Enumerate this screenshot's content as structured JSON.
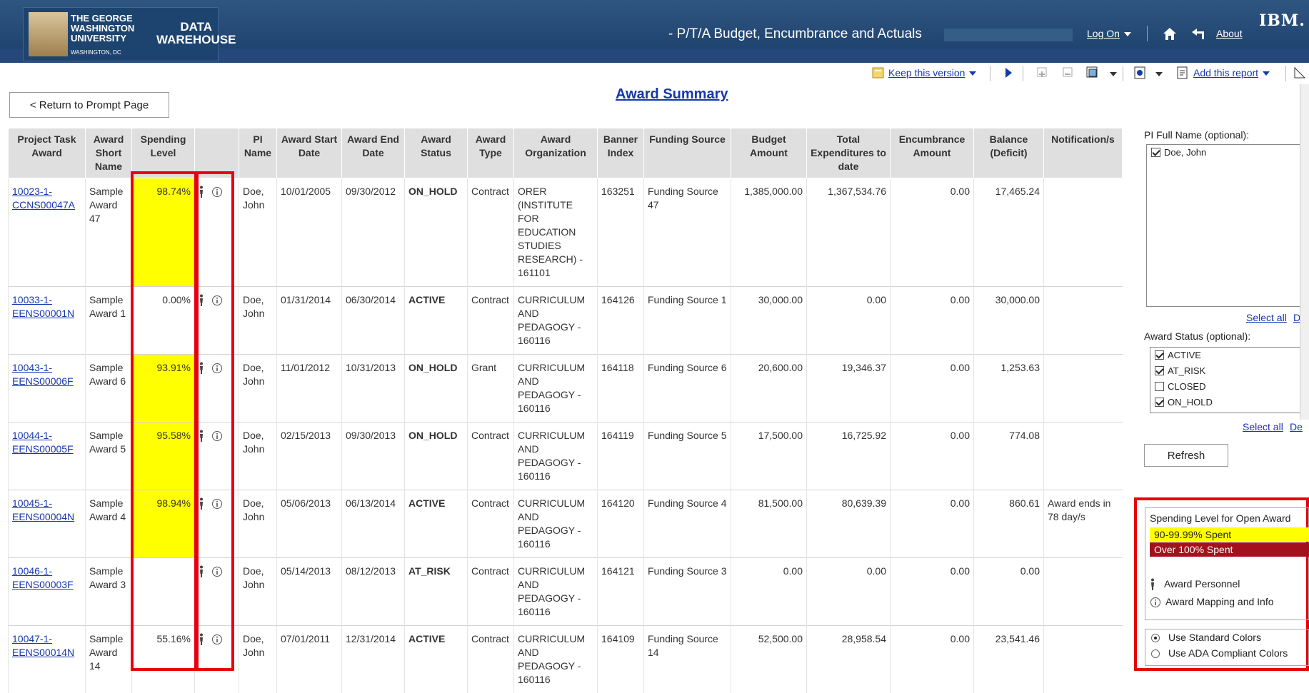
{
  "header": {
    "university": [
      "THE GEORGE",
      "WASHINGTON",
      "UNIVERSITY"
    ],
    "location": "WASHINGTON, DC",
    "product": [
      "DATA",
      "WAREHOUSE"
    ],
    "report_title": "- P/T/A Budget, Encumbrance and Actuals",
    "logon_label": "Log On",
    "about_label": "About",
    "ibm_label": "IBM."
  },
  "toolbar": {
    "keep_version_label": "Keep this version",
    "add_report_label": "Add this report"
  },
  "return_label": "< Return to Prompt Page",
  "page_title": "Award Summary",
  "table": {
    "headers": [
      "Project Task Award",
      "Award Short Name",
      "Spending Level",
      "",
      "PI Name",
      "Award Start Date",
      "Award End Date",
      "Award Status",
      "Award Type",
      "Award Organization",
      "Banner Index",
      "Funding Source",
      "Budget Amount",
      "Total Expenditures to date",
      "Encumbrance Amount",
      "Balance (Deficit)",
      "Notification/s"
    ],
    "rows": [
      {
        "project": "10023-1-CCNS00047A",
        "short_name": "Sample Award 47",
        "spending": "98.74%",
        "pi": "Doe, John",
        "start": "10/01/2005",
        "end": "09/30/2012",
        "status": "ON_HOLD",
        "type": "Contract",
        "org": "ORER (INSTITUTE FOR EDUCATION STUDIES RESEARCH) - 161101",
        "index": "163251",
        "funding": "Funding Source 47",
        "budget": "1,385,000.00",
        "expend": "1,367,534.76",
        "encumb": "0.00",
        "balance": "17,465.24",
        "notify": ""
      },
      {
        "project": "10033-1-EENS00001N",
        "short_name": "Sample Award 1",
        "spending": "0.00%",
        "pi": "Doe, John",
        "start": "01/31/2014",
        "end": "06/30/2014",
        "status": "ACTIVE",
        "type": "Contract",
        "org": "CURRICULUM AND PEDAGOGY - 160116",
        "index": "164126",
        "funding": "Funding Source 1",
        "budget": "30,000.00",
        "expend": "0.00",
        "encumb": "0.00",
        "balance": "30,000.00",
        "notify": ""
      },
      {
        "project": "10043-1-EENS00006F",
        "short_name": "Sample Award 6",
        "spending": "93.91%",
        "pi": "Doe, John",
        "start": "11/01/2012",
        "end": "10/31/2013",
        "status": "ON_HOLD",
        "type": "Grant",
        "org": "CURRICULUM AND PEDAGOGY - 160116",
        "index": "164118",
        "funding": "Funding Source 6",
        "budget": "20,600.00",
        "expend": "19,346.37",
        "encumb": "0.00",
        "balance": "1,253.63",
        "notify": ""
      },
      {
        "project": "10044-1-EENS00005F",
        "short_name": "Sample Award 5",
        "spending": "95.58%",
        "pi": "Doe, John",
        "start": "02/15/2013",
        "end": "09/30/2013",
        "status": "ON_HOLD",
        "type": "Contract",
        "org": "CURRICULUM AND PEDAGOGY - 160116",
        "index": "164119",
        "funding": "Funding Source 5",
        "budget": "17,500.00",
        "expend": "16,725.92",
        "encumb": "0.00",
        "balance": "774.08",
        "notify": ""
      },
      {
        "project": "10045-1-EENS00004N",
        "short_name": "Sample Award 4",
        "spending": "98.94%",
        "pi": "Doe, John",
        "start": "05/06/2013",
        "end": "06/13/2014",
        "status": "ACTIVE",
        "type": "Contract",
        "org": "CURRICULUM AND PEDAGOGY - 160116",
        "index": "164120",
        "funding": "Funding Source 4",
        "budget": "81,500.00",
        "expend": "80,639.39",
        "encumb": "0.00",
        "balance": "860.61",
        "notify": "Award ends in 78 day/s"
      },
      {
        "project": "10046-1-EENS00003F",
        "short_name": "Sample Award 3",
        "spending": "",
        "pi": "Doe, John",
        "start": "05/14/2013",
        "end": "08/12/2013",
        "status": "AT_RISK",
        "type": "Contract",
        "org": "CURRICULUM AND PEDAGOGY - 160116",
        "index": "164121",
        "funding": "Funding Source 3",
        "budget": "0.00",
        "expend": "0.00",
        "encumb": "0.00",
        "balance": "0.00",
        "notify": ""
      },
      {
        "project": "10047-1-EENS00014N",
        "short_name": "Sample Award 14",
        "spending": "55.16%",
        "pi": "Doe, John",
        "start": "07/01/2011",
        "end": "12/31/2014",
        "status": "ACTIVE",
        "type": "Contract",
        "org": "CURRICULUM AND PEDAGOGY - 160116",
        "index": "164109",
        "funding": "Funding Source 14",
        "budget": "52,500.00",
        "expend": "28,958.54",
        "encumb": "0.00",
        "balance": "23,541.46",
        "notify": ""
      }
    ]
  },
  "filters": {
    "pi_label": "PI Full Name (optional):",
    "pi_options": [
      {
        "label": "Doe, John",
        "checked": true
      }
    ],
    "select_all_label": "Select all",
    "deselect_label": "De",
    "status_label": "Award Status (optional):",
    "status_options": [
      {
        "label": "ACTIVE",
        "checked": true
      },
      {
        "label": "AT_RISK",
        "checked": true
      },
      {
        "label": "CLOSED",
        "checked": false
      },
      {
        "label": "ON_HOLD",
        "checked": true
      }
    ],
    "refresh_label": "Refresh"
  },
  "legend": {
    "title": "Spending Level for Open Award",
    "yellow_label": "90-99.99% Spent",
    "red_label": "Over 100% Spent",
    "personnel_label": "Award Personnel",
    "mapping_label": "Award Mapping and Info",
    "std_colors_label": "Use Standard Colors",
    "ada_colors_label": "Use ADA Compliant Colors"
  },
  "colors": {
    "header": "#1c3f6b",
    "link": "#1537b0",
    "on_hold": "#ff7a00",
    "active": "#1a9a12",
    "at_risk": "#e81c1c",
    "spend_warn": "#ffff00",
    "spend_over": "#a3121c",
    "highlight_box": "#e8000d"
  }
}
